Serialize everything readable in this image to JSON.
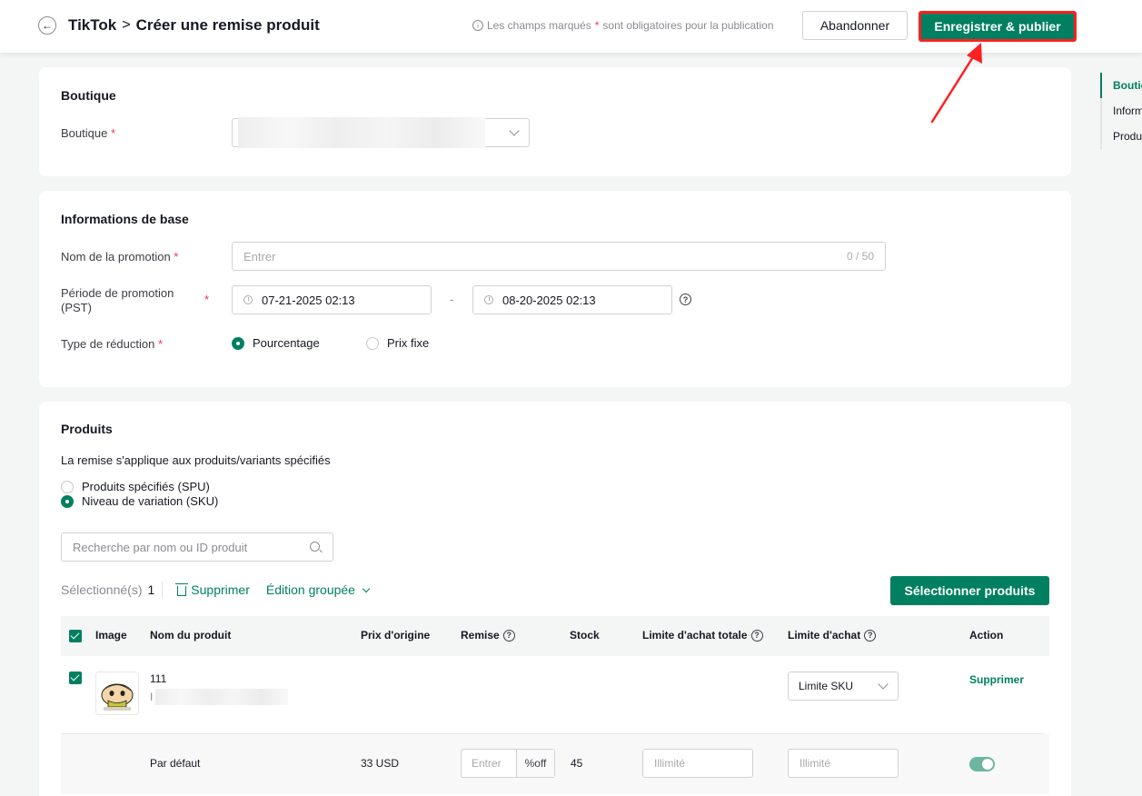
{
  "header": {
    "breadcrumb_root": "TikTok",
    "breadcrumb_sep": ">",
    "breadcrumb_page": "Créer une remise produit",
    "hint_before": "Les champs marqués",
    "hint_star": "*",
    "hint_after": "sont obligatoires pour la publication",
    "abandon_label": "Abandonner",
    "publish_label": "Enregistrer & publier"
  },
  "anchor_nav": {
    "items": [
      "Boutique",
      "Informations de base",
      "Produits"
    ],
    "active_index": 0
  },
  "boutique": {
    "title": "Boutique",
    "field_label": "Boutique",
    "required": "*"
  },
  "basic_info": {
    "title": "Informations de base",
    "name_label": "Nom de la promotion",
    "name_placeholder": "Entrer",
    "name_counter": "0 / 50",
    "period_label": "Période de promotion (PST)",
    "start_date": "07-21-2025 02:13",
    "range_sep": "-",
    "end_date": "08-20-2025 02:13",
    "discount_type_label": "Type de réduction",
    "discount_types": [
      {
        "label": "Pourcentage",
        "selected": true
      },
      {
        "label": "Prix fixe",
        "selected": false
      }
    ],
    "required": "*"
  },
  "products": {
    "title": "Produits",
    "scope_label": "La remise s'applique aux produits/variants spécifiés",
    "scope_options": [
      {
        "label": "Produits spécifiés (SPU)",
        "selected": false
      },
      {
        "label": "Niveau de variation (SKU)",
        "selected": true
      }
    ],
    "search_placeholder": "Recherche par nom ou ID produit",
    "selected_label": "Sélectionné(s)",
    "selected_count": "1",
    "delete_label": "Supprimer",
    "bulk_edit_label": "Édition groupée",
    "select_products_label": "Sélectionner produits",
    "columns": {
      "image": "Image",
      "name": "Nom du produit",
      "original_price": "Prix d'origine",
      "discount": "Remise",
      "stock": "Stock",
      "total_limit": "Limite d'achat totale",
      "purchase_limit": "Limite d'achat",
      "action": "Action"
    },
    "rows": [
      {
        "name": "111",
        "id_prefix": "I",
        "limit_select": "Limite SKU",
        "action": "Supprimer",
        "variant": {
          "name": "Par défaut",
          "price": "33 USD",
          "discount_placeholder": "Entrer",
          "discount_suffix": "%off",
          "stock": "45",
          "total_limit_placeholder": "Illimité",
          "purchase_limit_placeholder": "Illimité",
          "enabled": true
        }
      }
    ]
  },
  "colors": {
    "primary": "#008060",
    "required": "#fe2c55",
    "annotation": "#ff2020"
  }
}
